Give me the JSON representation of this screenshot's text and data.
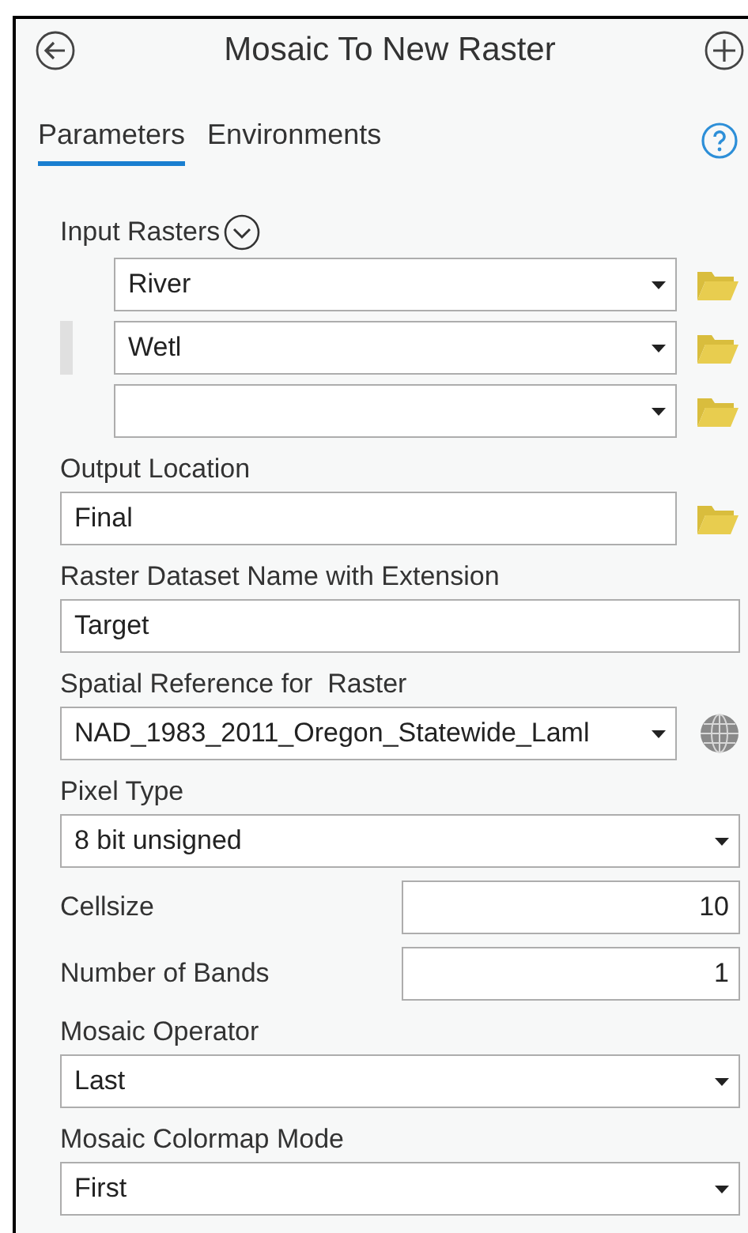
{
  "header": {
    "title": "Mosaic To New Raster"
  },
  "tabs": [
    {
      "label": "Parameters",
      "selected": true
    },
    {
      "label": "Environments",
      "selected": false
    }
  ],
  "params": [
    {
      "kind": "multi",
      "label": "Input Rasters",
      "expanded": true,
      "rows": [
        {
          "value": "River",
          "selected": false
        },
        {
          "value": "Wetl",
          "selected": true
        },
        {
          "value": "",
          "selected": false
        }
      ]
    },
    {
      "kind": "browse",
      "label": "Output Location",
      "value": "Final"
    },
    {
      "kind": "text",
      "label": "Raster Dataset Name with Extension",
      "value": "Target"
    },
    {
      "kind": "spatial",
      "label": "Spatial Reference for  Raster",
      "value": "NAD_1983_2011_Oregon_Statewide_Laml"
    },
    {
      "kind": "dropdown",
      "label": "Pixel Type",
      "value": "8 bit unsigned"
    },
    {
      "kind": "inline",
      "label": "Cellsize",
      "value": "10"
    },
    {
      "kind": "inline",
      "label": "Number of Bands",
      "value": "1"
    },
    {
      "kind": "dropdown",
      "label": "Mosaic Operator",
      "value": "Last"
    },
    {
      "kind": "dropdown",
      "label": "Mosaic Colormap Mode",
      "value": "First"
    }
  ]
}
